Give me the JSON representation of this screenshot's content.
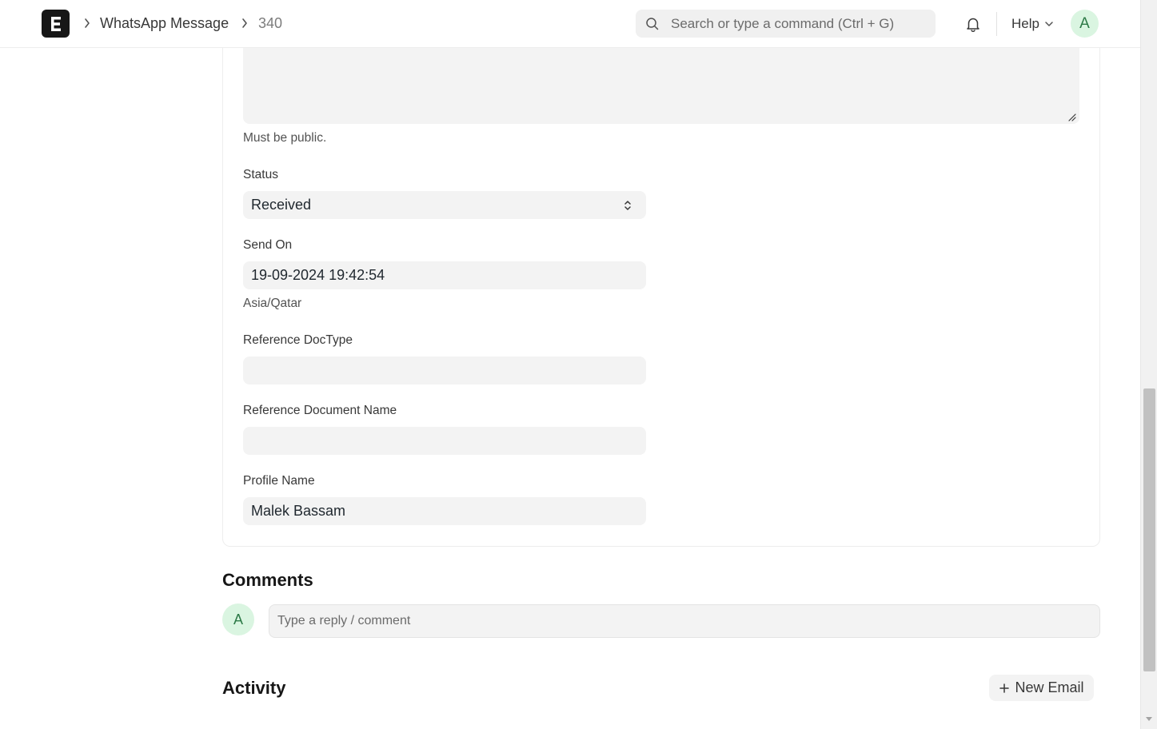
{
  "header": {
    "app_logo_letter": "E",
    "breadcrumbs": [
      "WhatsApp Message",
      "340"
    ],
    "search": {
      "placeholder": "Search or type a command (Ctrl + G)"
    },
    "help_label": "Help",
    "user_initial": "A"
  },
  "form": {
    "textarea_hint": "Must be public.",
    "fields": [
      {
        "label": "Status",
        "value": "Received",
        "type": "select"
      },
      {
        "label": "Send On",
        "value": "19-09-2024 19:42:54",
        "hint": "Asia/Qatar",
        "type": "datetime"
      },
      {
        "label": "Reference DocType",
        "value": "",
        "type": "link"
      },
      {
        "label": "Reference Document Name",
        "value": "",
        "type": "dynamic-link"
      },
      {
        "label": "Profile Name",
        "value": "Malek Bassam",
        "type": "data"
      }
    ]
  },
  "comments": {
    "title": "Comments",
    "user_initial": "A",
    "placeholder": "Type a reply / comment"
  },
  "activity": {
    "title": "Activity",
    "new_email_label": "New Email"
  },
  "colors": {
    "field_bg": "#f3f3f3",
    "avatar_bg": "#daf5e1",
    "avatar_text": "#2d7a47",
    "logo_bg": "#171717"
  }
}
